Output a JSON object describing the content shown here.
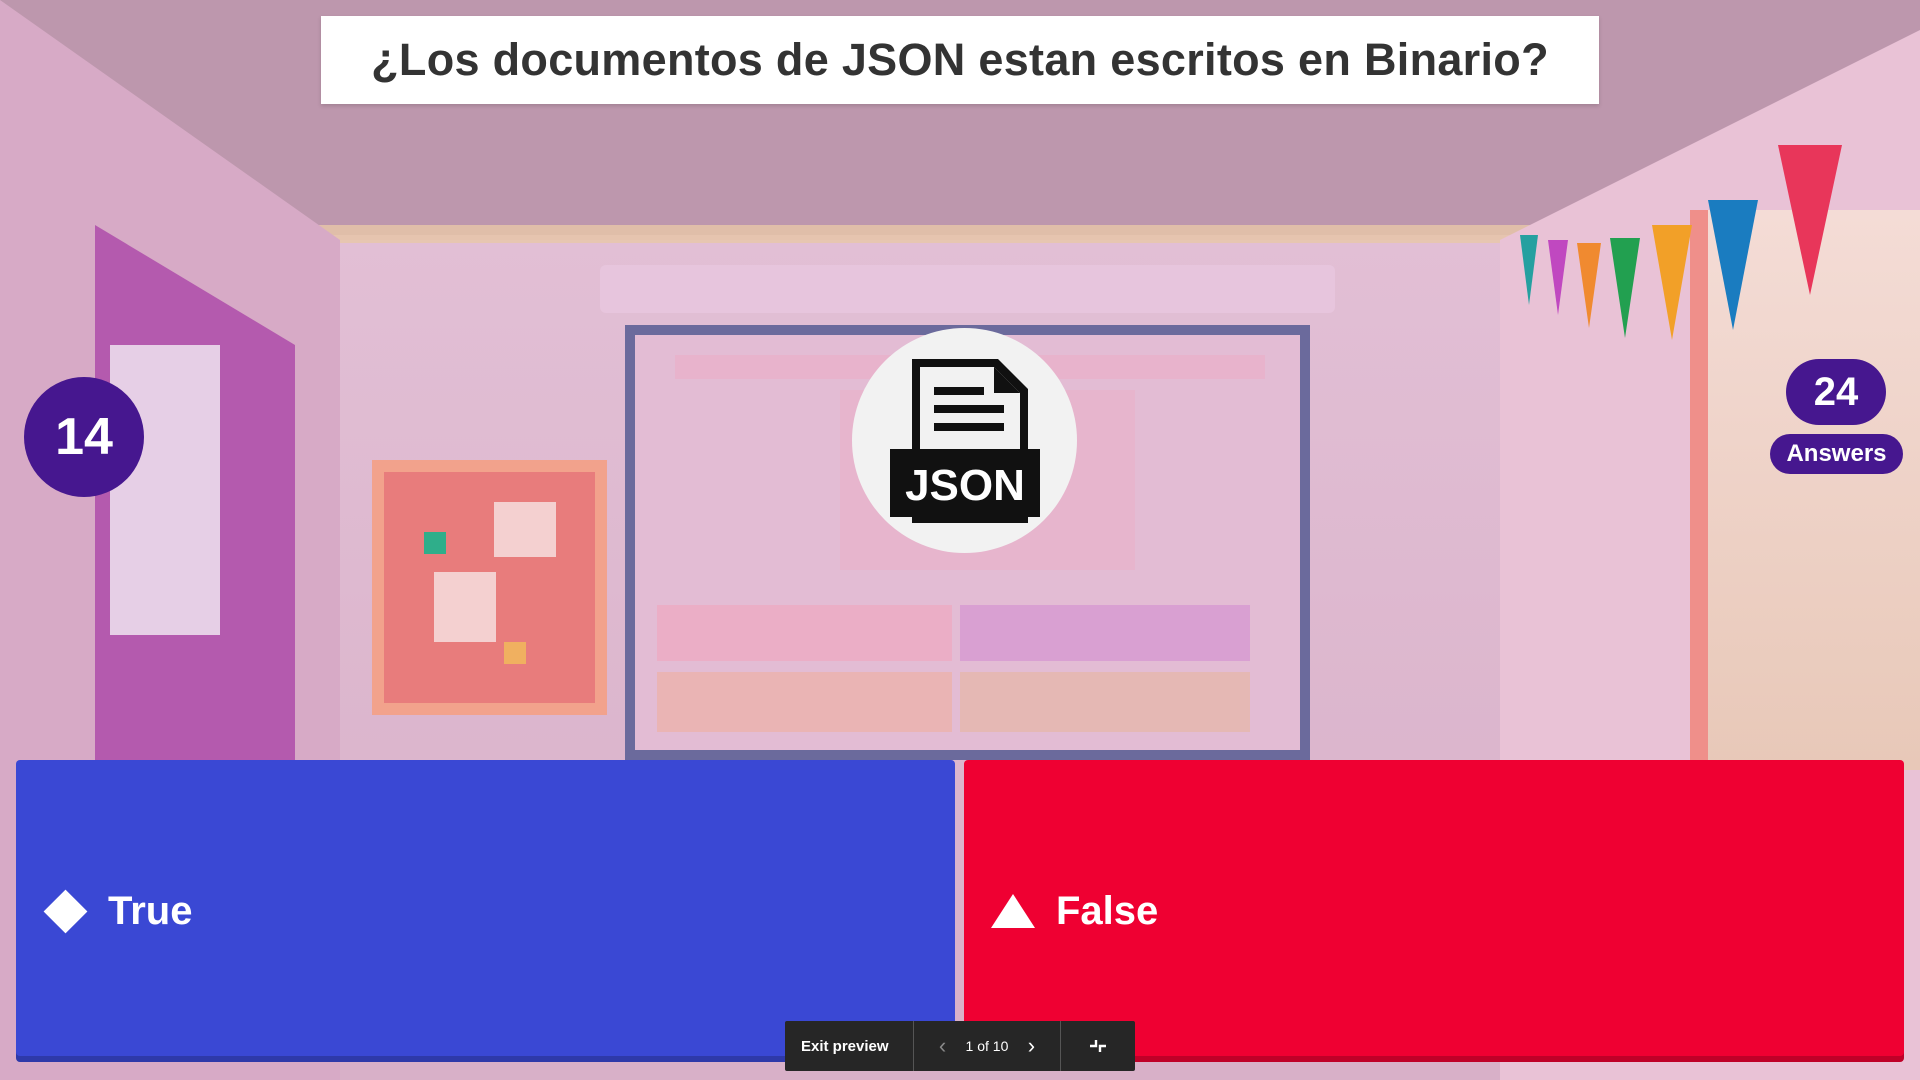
{
  "question": {
    "text": "¿Los documentos de JSON estan escritos en Binario?"
  },
  "media": {
    "icon": "json-file-icon",
    "label": "JSON"
  },
  "timer": {
    "value": "14"
  },
  "answers_counter": {
    "count": "24",
    "label": "Answers"
  },
  "answers": [
    {
      "shape": "diamond",
      "label": "True",
      "color": "#3a48d4"
    },
    {
      "shape": "triangle",
      "label": "False",
      "color": "#ef0032"
    }
  ],
  "preview_bar": {
    "exit_label": "Exit preview",
    "page_indicator": "1 of 10",
    "prev_icon": "chevron-left-icon",
    "next_icon": "chevron-right-icon",
    "fullscreen_icon": "collapse-icon"
  },
  "theme": {
    "primary": "#46178f",
    "background": "classroom"
  }
}
